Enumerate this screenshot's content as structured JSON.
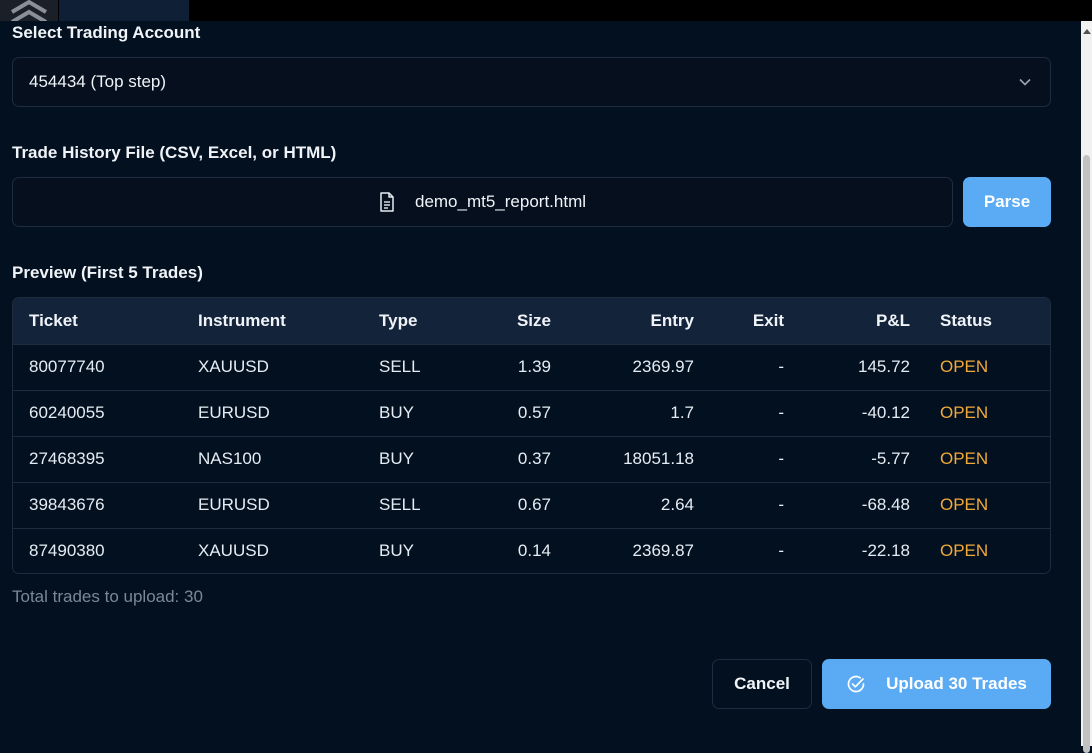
{
  "form": {
    "account_label": "Select Trading Account",
    "account_value": "454434 (Top step)",
    "file_label": "Trade History File (CSV, Excel, or HTML)",
    "file_name": "demo_mt5_report.html",
    "parse_label": "Parse",
    "preview_label": "Preview (First 5 Trades)",
    "total_text": "Total trades to upload: 30",
    "cancel_label": "Cancel",
    "upload_label": "Upload 30 Trades"
  },
  "table": {
    "headers": [
      "Ticket",
      "Instrument",
      "Type",
      "Size",
      "Entry",
      "Exit",
      "P&L",
      "Status"
    ],
    "rows": [
      [
        "80077740",
        "XAUUSD",
        "SELL",
        "1.39",
        "2369.97",
        "-",
        "145.72",
        "OPEN"
      ],
      [
        "60240055",
        "EURUSD",
        "BUY",
        "0.57",
        "1.7",
        "-",
        "-40.12",
        "OPEN"
      ],
      [
        "27468395",
        "NAS100",
        "BUY",
        "0.37",
        "18051.18",
        "-",
        "-5.77",
        "OPEN"
      ],
      [
        "39843676",
        "EURUSD",
        "SELL",
        "0.67",
        "2.64",
        "-",
        "-68.48",
        "OPEN"
      ],
      [
        "87490380",
        "XAUUSD",
        "BUY",
        "0.14",
        "2369.87",
        "-",
        "-22.18",
        "OPEN"
      ]
    ]
  },
  "icons": {
    "select": "chevron-down-icon",
    "file": "document-icon",
    "upload": "check-circle-icon"
  },
  "colors": {
    "accent": "#5aabf4",
    "status_open": "#f2a93b",
    "background": "#03101f"
  }
}
